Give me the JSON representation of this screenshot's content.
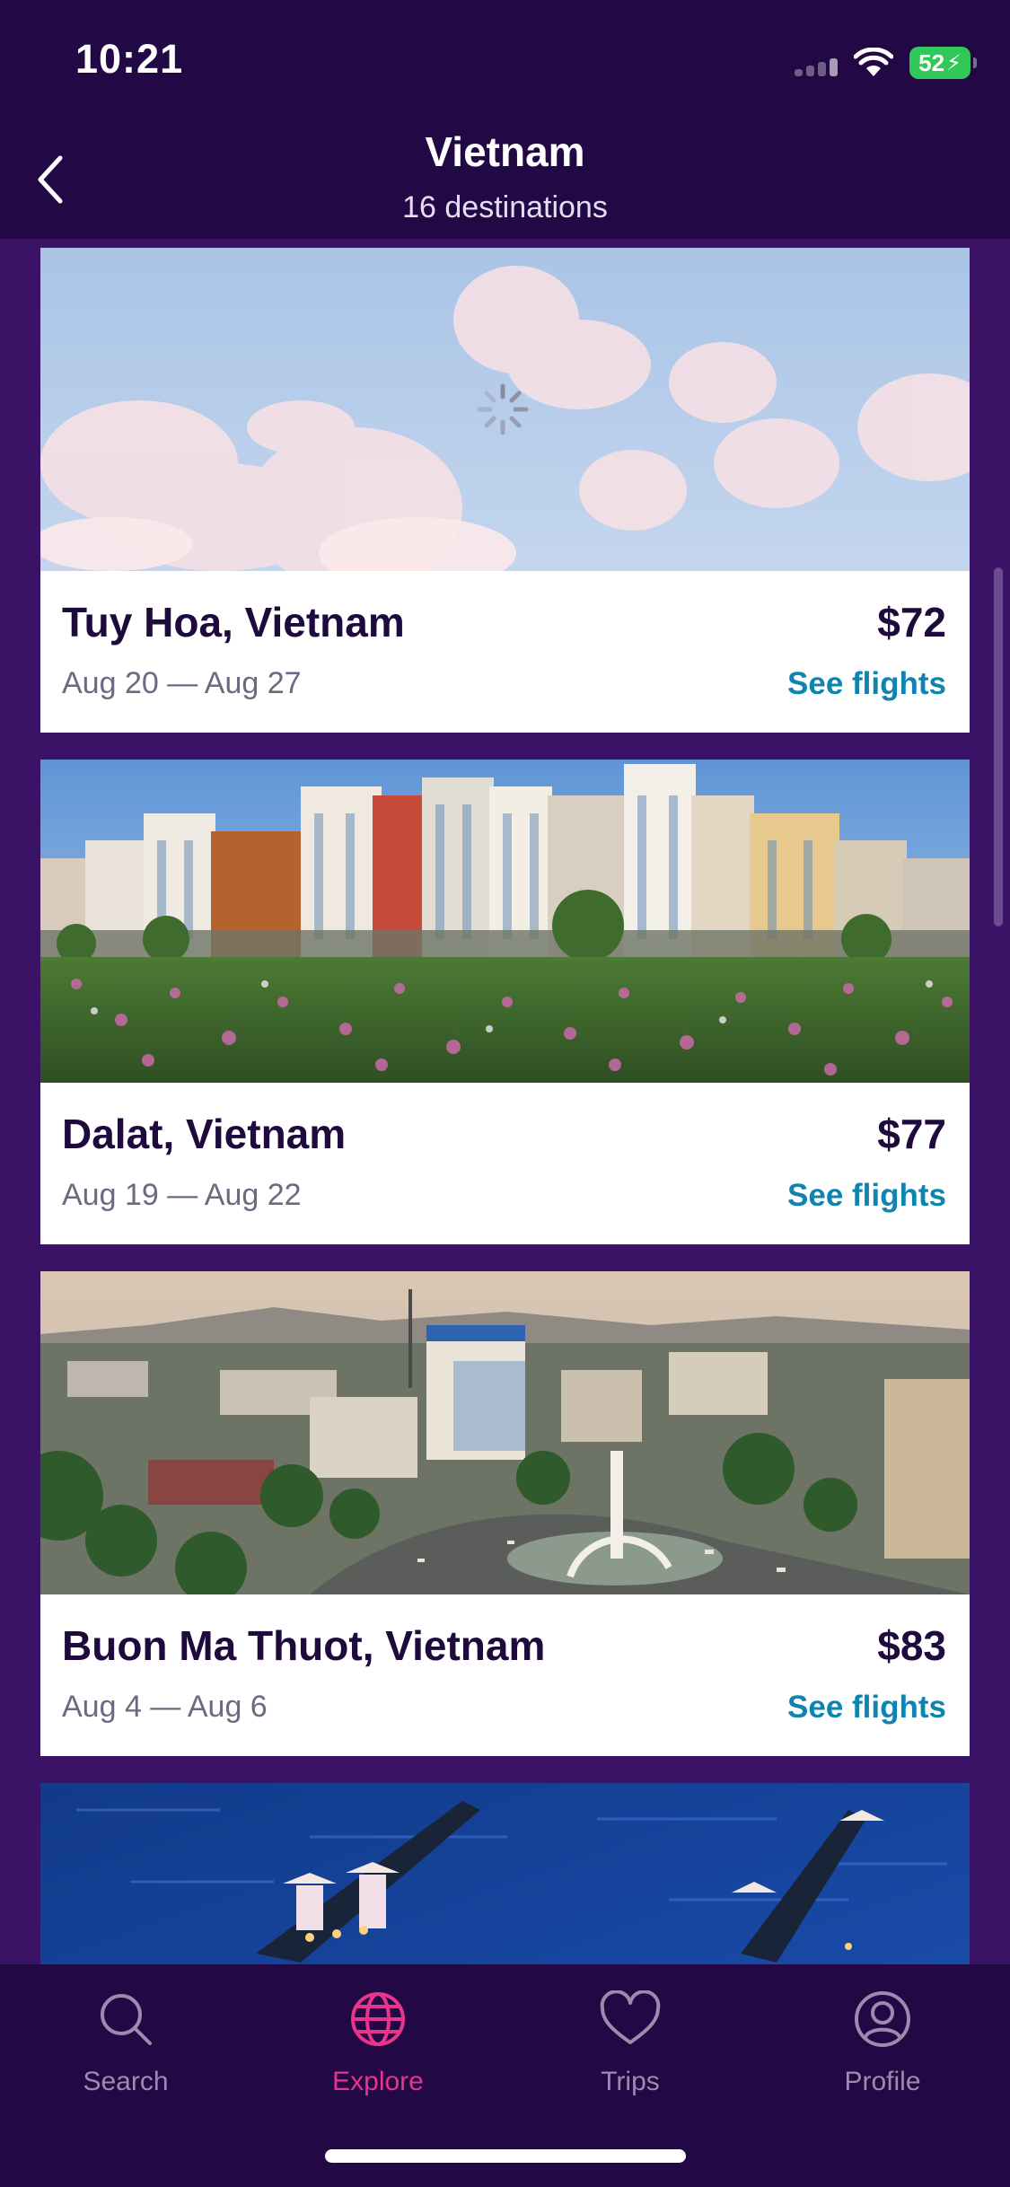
{
  "status_bar": {
    "time": "10:21",
    "battery": "52"
  },
  "header": {
    "title": "Vietnam",
    "subtitle": "16 destinations"
  },
  "cards": [
    {
      "name": "Tuy Hoa, Vietnam",
      "dates": "Aug 20 — Aug 27",
      "price": "$72",
      "link": "See flights",
      "image": "sky-clouds-loading"
    },
    {
      "name": "Dalat, Vietnam",
      "dates": "Aug 19 — Aug 22",
      "price": "$77",
      "link": "See flights",
      "image": "city-flower-field"
    },
    {
      "name": "Buon Ma Thuot, Vietnam",
      "dates": "Aug 4 — Aug 6",
      "price": "$83",
      "link": "See flights",
      "image": "city-aerial-roundabout"
    },
    {
      "image": "river-boats-dusk"
    }
  ],
  "tabs": [
    {
      "label": "Search",
      "icon": "search-icon",
      "active": false
    },
    {
      "label": "Explore",
      "icon": "globe-icon",
      "active": true
    },
    {
      "label": "Trips",
      "icon": "heart-icon",
      "active": false
    },
    {
      "label": "Profile",
      "icon": "profile-icon",
      "active": false
    }
  ],
  "colors": {
    "background": "#3a1266",
    "bar": "#220844",
    "accent": "#e8348b",
    "link": "#0f84b1"
  }
}
